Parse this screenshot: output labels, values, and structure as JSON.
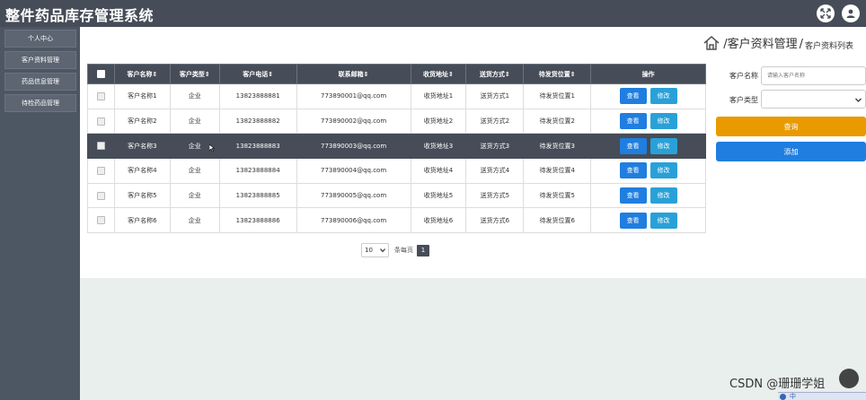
{
  "app": {
    "title": "整件药品库存管理系统"
  },
  "sidebar": {
    "items": [
      {
        "label": "个人中心"
      },
      {
        "label": "客户资料管理"
      },
      {
        "label": "药品信息管理"
      },
      {
        "label": "待检药品管理"
      }
    ]
  },
  "breadcrumb": {
    "section": "客户资料管理",
    "separator": "/",
    "page": "客户资料列表"
  },
  "table": {
    "headers": [
      "客户名称⇕",
      "客户类型⇕",
      "客户电话⇕",
      "联系邮箱⇕",
      "收货地址⇕",
      "送货方式⇕",
      "待发货位置⇕",
      "操作"
    ],
    "rows": [
      {
        "name": "客户名称1",
        "type": "企业",
        "phone": "13823888881",
        "email": "773890001@qq.com",
        "address": "收货地址1",
        "delivery": "送货方式1",
        "location": "待发货位置1"
      },
      {
        "name": "客户名称2",
        "type": "企业",
        "phone": "13823888882",
        "email": "773890002@qq.com",
        "address": "收货地址2",
        "delivery": "送货方式2",
        "location": "待发货位置2"
      },
      {
        "name": "客户名称3",
        "type": "企业",
        "phone": "13823888883",
        "email": "773890003@qq.com",
        "address": "收货地址3",
        "delivery": "送货方式3",
        "location": "待发货位置3"
      },
      {
        "name": "客户名称4",
        "type": "企业",
        "phone": "13823888884",
        "email": "773890004@qq.com",
        "address": "收货地址4",
        "delivery": "送货方式4",
        "location": "待发货位置4"
      },
      {
        "name": "客户名称5",
        "type": "企业",
        "phone": "13823888885",
        "email": "773890005@qq.com",
        "address": "收货地址5",
        "delivery": "送货方式5",
        "location": "待发货位置5"
      },
      {
        "name": "客户名称6",
        "type": "企业",
        "phone": "13823888886",
        "email": "773890006@qq.com",
        "address": "收货地址6",
        "delivery": "送货方式6",
        "location": "待发货位置6"
      }
    ],
    "selected_row": 3,
    "view_label": "查看",
    "edit_label": "修改"
  },
  "pager": {
    "page_size": "10",
    "per_page_label": "条每页",
    "current_page": "1"
  },
  "search": {
    "name_label": "客户名称",
    "name_placeholder": "请输入客户名称",
    "type_label": "客户类型",
    "type_value": "",
    "query_label": "查询",
    "add_label": "添加"
  },
  "watermark": "CSDN @珊珊学姐",
  "ime": {
    "label": "中"
  },
  "colors": {
    "header": "#464d58",
    "query": "#e89a00",
    "primary": "#1f7ee0",
    "edit": "#29a1d8"
  },
  "icons": [
    "fullscreen-icon",
    "user-icon",
    "home-icon"
  ]
}
